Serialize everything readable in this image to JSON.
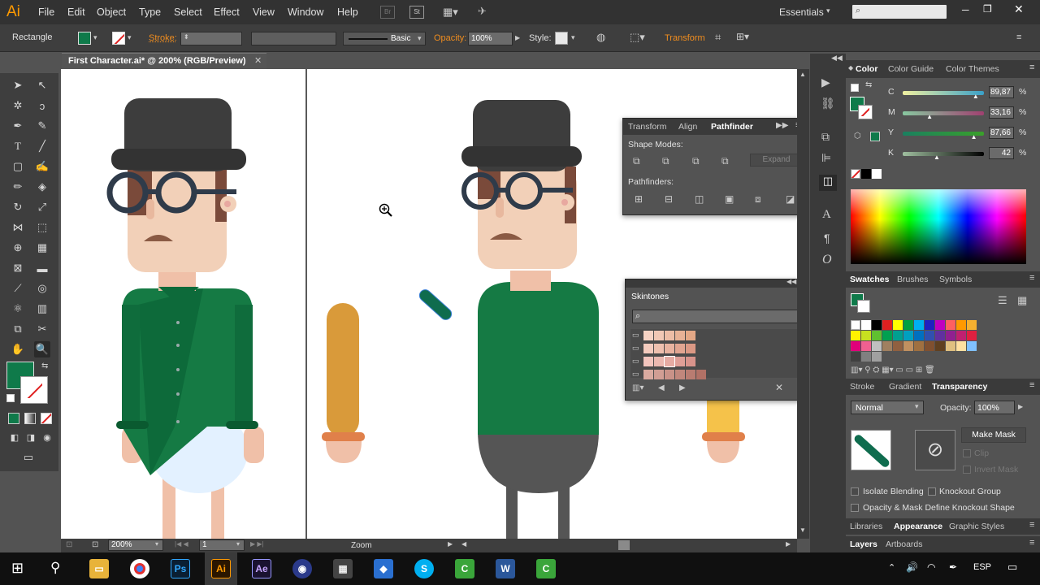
{
  "app": {
    "logo": "Ai"
  },
  "menu": [
    "File",
    "Edit",
    "Object",
    "Type",
    "Select",
    "Effect",
    "View",
    "Window",
    "Help"
  ],
  "workspace": "Essentials",
  "control": {
    "object_type": "Rectangle",
    "stroke_label": "Stroke:",
    "stroke_profile": "Basic",
    "opacity_label": "Opacity:",
    "opacity_value": "100%",
    "style_label": "Style:",
    "transform_label": "Transform"
  },
  "document": {
    "tab_title": "First Character.ai* @ 200% (RGB/Preview)"
  },
  "status": {
    "zoom": "200%",
    "artboard": "1",
    "tool_name": "Zoom"
  },
  "color_panel": {
    "tabs": [
      "Color",
      "Color Guide",
      "Color Themes"
    ],
    "channels": [
      {
        "label": "C",
        "value": "89,87",
        "pct": 0.8987
      },
      {
        "label": "M",
        "value": "33,16",
        "pct": 0.3316
      },
      {
        "label": "Y",
        "value": "87,66",
        "pct": 0.8766
      },
      {
        "label": "K",
        "value": "42",
        "pct": 0.42
      }
    ],
    "unit": "%",
    "fill_color": "#0f7a4a"
  },
  "pathfinder": {
    "tabs": [
      "Transform",
      "Align",
      "Pathfinder"
    ],
    "shape_modes_label": "Shape Modes:",
    "pathfinders_label": "Pathfinders:",
    "expand_label": "Expand"
  },
  "skintones": {
    "title": "Skintones"
  },
  "swatches_panel": {
    "tabs": [
      "Swatches",
      "Brushes",
      "Symbols"
    ]
  },
  "transparency": {
    "tabs": [
      "Stroke",
      "Gradient",
      "Transparency"
    ],
    "blend_mode": "Normal",
    "opacity_label": "Opacity:",
    "opacity_value": "100%",
    "make_mask": "Make Mask",
    "clip": "Clip",
    "invert_mask": "Invert Mask",
    "isolate_blending": "Isolate Blending",
    "knockout_group": "Knockout Group",
    "opacity_mask_define": "Opacity & Mask Define Knockout Shape"
  },
  "bottom_tabs1": [
    "Libraries",
    "Appearance",
    "Graphic Styles"
  ],
  "bottom_tabs2": [
    "Layers",
    "Artboards"
  ],
  "taskbar": {
    "lang": "ESP"
  }
}
